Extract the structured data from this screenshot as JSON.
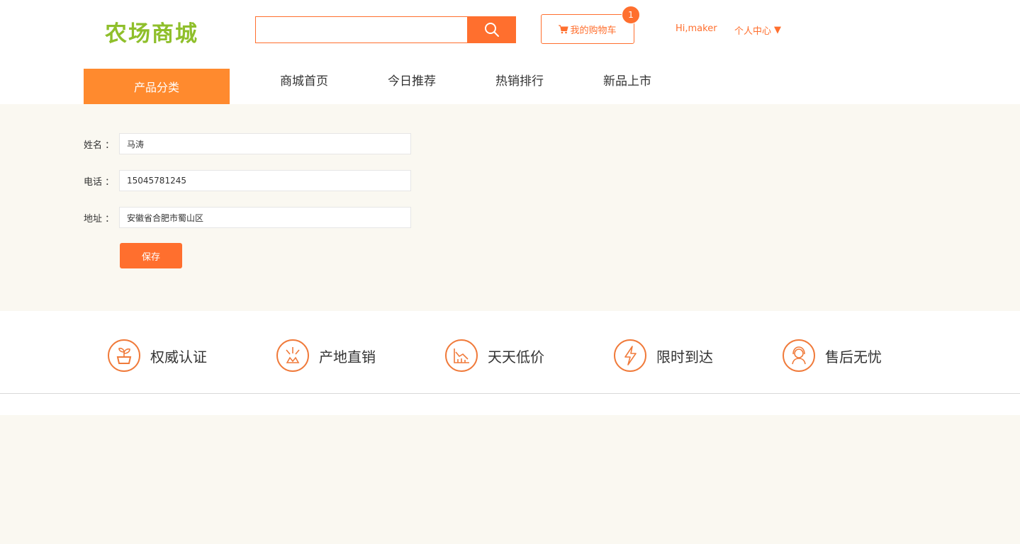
{
  "brand": {
    "logo_text": "农场商城"
  },
  "search": {
    "placeholder": ""
  },
  "cart": {
    "label": "我的购物车",
    "count": "1"
  },
  "user": {
    "greeting": "Hi,maker",
    "center_label": "个人中心",
    "center_arrow": "▼"
  },
  "nav": {
    "category_label": "产品分类",
    "links": [
      "商城首页",
      "今日推荐",
      "热销排行",
      "新品上市"
    ]
  },
  "form": {
    "name_label": "姓名 ：",
    "name_value": "马涛",
    "phone_label": "电话 ：",
    "phone_value": "15045781245",
    "address_label": "地址 ：",
    "address_value": "安徽省合肥市蜀山区",
    "save_label": "保存"
  },
  "features": [
    {
      "label": "权威认证",
      "icon": "plant-pot-icon"
    },
    {
      "label": "产地直销",
      "icon": "origin-burst-icon"
    },
    {
      "label": "天天低价",
      "icon": "price-chart-icon"
    },
    {
      "label": "限时到达",
      "icon": "lightning-icon"
    },
    {
      "label": "售后无忧",
      "icon": "customer-service-icon"
    }
  ],
  "colors": {
    "accent": "#ff6f2e",
    "category": "#ff8a2e",
    "logo": "#8fbf2b",
    "page_bg": "#faf8f1"
  }
}
